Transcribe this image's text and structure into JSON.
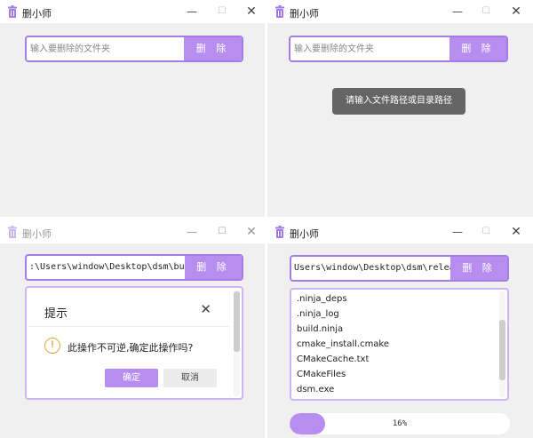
{
  "app": {
    "title": "删小师",
    "icon": "trash-icon",
    "accent": "#b78ef0"
  },
  "window_controls": {
    "minimize": "—",
    "maximize": "☐",
    "close": "✕"
  },
  "search": {
    "placeholder": "输入要删除的文件夹",
    "delete_label": "删 除"
  },
  "panel2": {
    "toast": "请输入文件路径或目录路径"
  },
  "panel3": {
    "path": ":\\Users\\window\\Desktop\\dsm\\build",
    "dialog": {
      "title": "提示",
      "icon": "warning-icon",
      "icon_glyph": "!",
      "message": "此操作不可逆,确定此操作吗?",
      "confirm_label": "确定",
      "cancel_label": "取消"
    }
  },
  "panel4": {
    "path": "Users\\window\\Desktop\\dsm\\release",
    "files": [
      ".ninja_deps",
      ".ninja_log",
      "build.ninja",
      "cmake_install.cmake",
      "CMakeCache.txt",
      "CMakeFiles",
      "dsm.exe"
    ],
    "progress_text": "16%",
    "progress_value": 0.16
  }
}
